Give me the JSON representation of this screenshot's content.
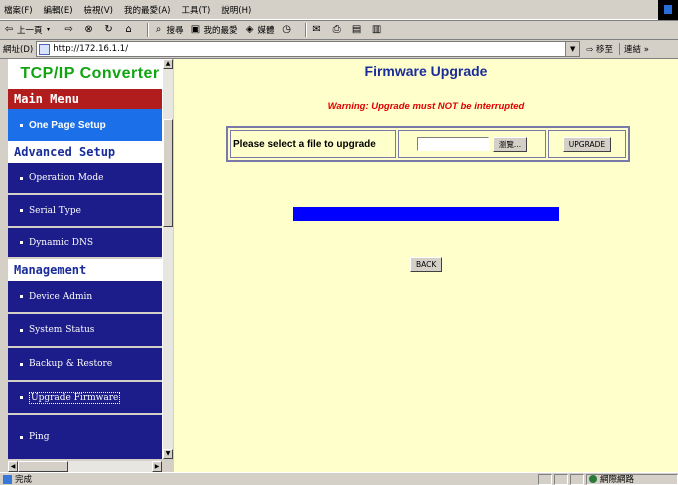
{
  "browser": {
    "menu": [
      "檔案(F)",
      "編輯(E)",
      "檢視(V)",
      "我的最愛(A)",
      "工具(T)",
      "說明(H)"
    ],
    "toolbar": {
      "back_label": "上一頁",
      "search_label": "搜尋",
      "favorites_label": "我的最愛",
      "media_label": "媒體"
    },
    "address": {
      "label": "網址(D)",
      "url": "http://172.16.1.1/",
      "go_label": "移至",
      "links_label": "連結 »"
    },
    "status": {
      "text": "完成",
      "zone": "網際網路"
    }
  },
  "sidebar": {
    "brand": "TCP/IP Converter",
    "main_menu": {
      "title": "Main Menu",
      "items": [
        {
          "label": "One Page Setup"
        }
      ]
    },
    "advanced_setup": {
      "title": "Advanced Setup",
      "items": [
        {
          "label": "Operation Mode"
        },
        {
          "label": "Serial Type"
        },
        {
          "label": "Dynamic DNS"
        }
      ]
    },
    "management": {
      "title": "Management",
      "items": [
        {
          "label": "Device Admin"
        },
        {
          "label": "System Status"
        },
        {
          "label": "Backup & Restore"
        },
        {
          "label": "Upgrade Firmware"
        },
        {
          "label": "Ping"
        }
      ]
    }
  },
  "main": {
    "title": "Firmware Upgrade",
    "warning": "Warning: Upgrade must NOT be interrupted",
    "file_prompt": "Please select a file to upgrade",
    "file_input_value": "",
    "browse_label": "瀏覽...",
    "upgrade_label": "UPGRADE",
    "progress_percent": 100,
    "back_label": "BACK"
  },
  "colors": {
    "content_bg": "#ffffcc",
    "nav_bg": "#1c1c8a",
    "nav_active_bg": "#1b6fe8",
    "section_red": "#b11d1d",
    "brand_green": "#10a410",
    "title_blue": "#1a2c9a",
    "warning_red": "#e00000",
    "progress_blue": "#0000ff"
  }
}
